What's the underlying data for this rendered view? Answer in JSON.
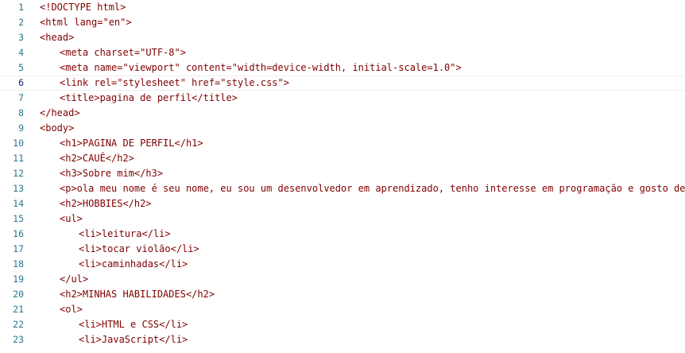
{
  "editor": {
    "lines": [
      {
        "num": "1",
        "text": "<!DOCTYPE html>"
      },
      {
        "num": "2",
        "text": "<html lang=\"en\">"
      },
      {
        "num": "3",
        "text": "<head>"
      },
      {
        "num": "4",
        "text": "<meta charset=\"UTF-8\">"
      },
      {
        "num": "5",
        "text": "<meta name=\"viewport\" content=\"width=device-width, initial-scale=1.0\">"
      },
      {
        "num": "6",
        "text": "<link rel=\"stylesheet\" href=\"style.css\">"
      },
      {
        "num": "7",
        "text": "<title>pagina de perfil</title>"
      },
      {
        "num": "8",
        "text": "</head>"
      },
      {
        "num": "9",
        "text": "<body>"
      },
      {
        "num": "10",
        "text": "<h1>PAGINA DE PERFIL</h1>"
      },
      {
        "num": "11",
        "text": "<h2>CAUÊ</h2>"
      },
      {
        "num": "12",
        "text": "<h3>Sobre mim</h3>"
      },
      {
        "num": "13",
        "text": "<p>ola meu nome é seu nome, eu sou um desenvolvedor em aprendizado, tenho interesse em programação e gosto de aprender coisas todos os"
      },
      {
        "num": "14",
        "text": "<h2>HOBBIES</h2>"
      },
      {
        "num": "15",
        "text": "<ul>"
      },
      {
        "num": "16",
        "text": "<li>leitura</li>"
      },
      {
        "num": "17",
        "text": "<li>tocar violão</li>"
      },
      {
        "num": "18",
        "text": "<li>caminhadas</li>"
      },
      {
        "num": "19",
        "text": "</ul>"
      },
      {
        "num": "20",
        "text": "<h2>MINHAS HABILIDADES</h2>"
      },
      {
        "num": "21",
        "text": "<ol>"
      },
      {
        "num": "22",
        "text": "<li>HTML e CSS</li>"
      },
      {
        "num": "23",
        "text": "<li>JavaScript</li>"
      }
    ],
    "active_line": "6"
  },
  "colors": {
    "tag": "#800000",
    "attribute": "#e50000",
    "string": "#0000ff",
    "line_number": "#237893",
    "background": "#ffffff"
  }
}
